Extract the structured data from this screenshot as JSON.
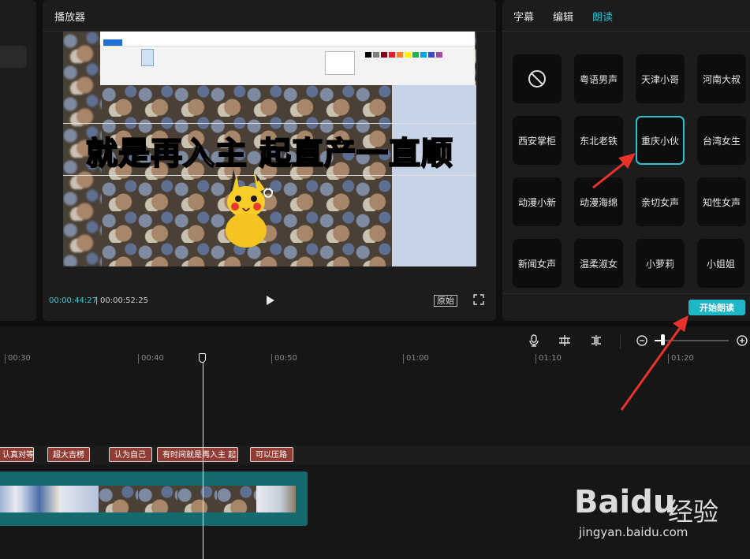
{
  "player": {
    "title": "播放器",
    "overlay_text": "就是再入主 起直产一直顺",
    "time_current": "00:00:44:27",
    "time_separator": "|",
    "time_total": "00:00:52:25",
    "ratio_label": "原始"
  },
  "right_panel": {
    "tabs": [
      {
        "label": "字幕",
        "active": false
      },
      {
        "label": "编辑",
        "active": false
      },
      {
        "label": "朗读",
        "active": true
      }
    ],
    "voices": [
      {
        "label": "",
        "icon": "none-icon"
      },
      {
        "label": "粤语男声"
      },
      {
        "label": "天津小哥"
      },
      {
        "label": "河南大叔"
      },
      {
        "label": "西安掌柜"
      },
      {
        "label": "东北老铁"
      },
      {
        "label": "重庆小伙",
        "selected": true
      },
      {
        "label": "台湾女生"
      },
      {
        "label": "动漫小新"
      },
      {
        "label": "动漫海绵"
      },
      {
        "label": "亲切女声"
      },
      {
        "label": "知性女声"
      },
      {
        "label": "新闻女声"
      },
      {
        "label": "温柔淑女"
      },
      {
        "label": "小萝莉"
      },
      {
        "label": "小姐姐"
      }
    ],
    "start_button": "开始朗读"
  },
  "timeline": {
    "ruler": [
      "00:30",
      "00:40",
      "00:50",
      "01:00",
      "01:10",
      "01:20"
    ],
    "subtitle_clips": [
      "认真对等",
      "超大吉楞",
      "认为自己",
      "有时间就是再入主 起",
      "可以压路"
    ]
  },
  "watermark": {
    "brand": "Baidu",
    "brand_cn": "经验",
    "url": "jingyan.baidu.com"
  },
  "colors": {
    "accent": "#1fb7c6",
    "subtitle_clip": "#8f3c34",
    "video_track": "#156a70",
    "arrow": "#e8322c"
  }
}
